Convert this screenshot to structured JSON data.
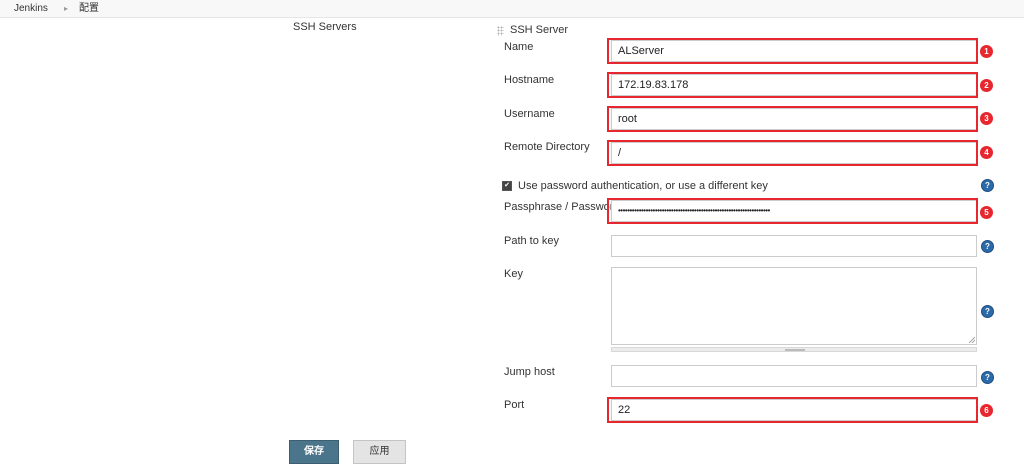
{
  "breadcrumb": {
    "items": [
      "Jenkins",
      "配置"
    ],
    "separator": "▸"
  },
  "section": {
    "label": "SSH Servers",
    "header": "SSH Server"
  },
  "fields": {
    "name": {
      "label": "Name",
      "value": "ALServer",
      "badge": "1"
    },
    "hostname": {
      "label": "Hostname",
      "value": "172.19.83.178",
      "badge": "2"
    },
    "username": {
      "label": "Username",
      "value": "root",
      "badge": "3"
    },
    "remote_directory": {
      "label": "Remote Directory",
      "value": "/",
      "badge": "4"
    },
    "use_password": {
      "label": "Use password authentication, or use a different key",
      "checked": true
    },
    "passphrase": {
      "label": "Passphrase / Password",
      "value": "••••••••••••••••••••••••••••••••••••••••••••••••••••••••••••••••••",
      "badge": "5"
    },
    "path_to_key": {
      "label": "Path to key",
      "value": ""
    },
    "key": {
      "label": "Key",
      "value": ""
    },
    "jump_host": {
      "label": "Jump host",
      "value": ""
    },
    "port": {
      "label": "Port",
      "value": "22",
      "badge": "6"
    }
  },
  "help_icon": "?",
  "check_mark": "✔",
  "buttons": {
    "save": "保存",
    "apply": "应用"
  },
  "colors": {
    "highlight": "#e8262d",
    "save_button": "#4b758b",
    "help_icon": "#2b6aa8"
  }
}
